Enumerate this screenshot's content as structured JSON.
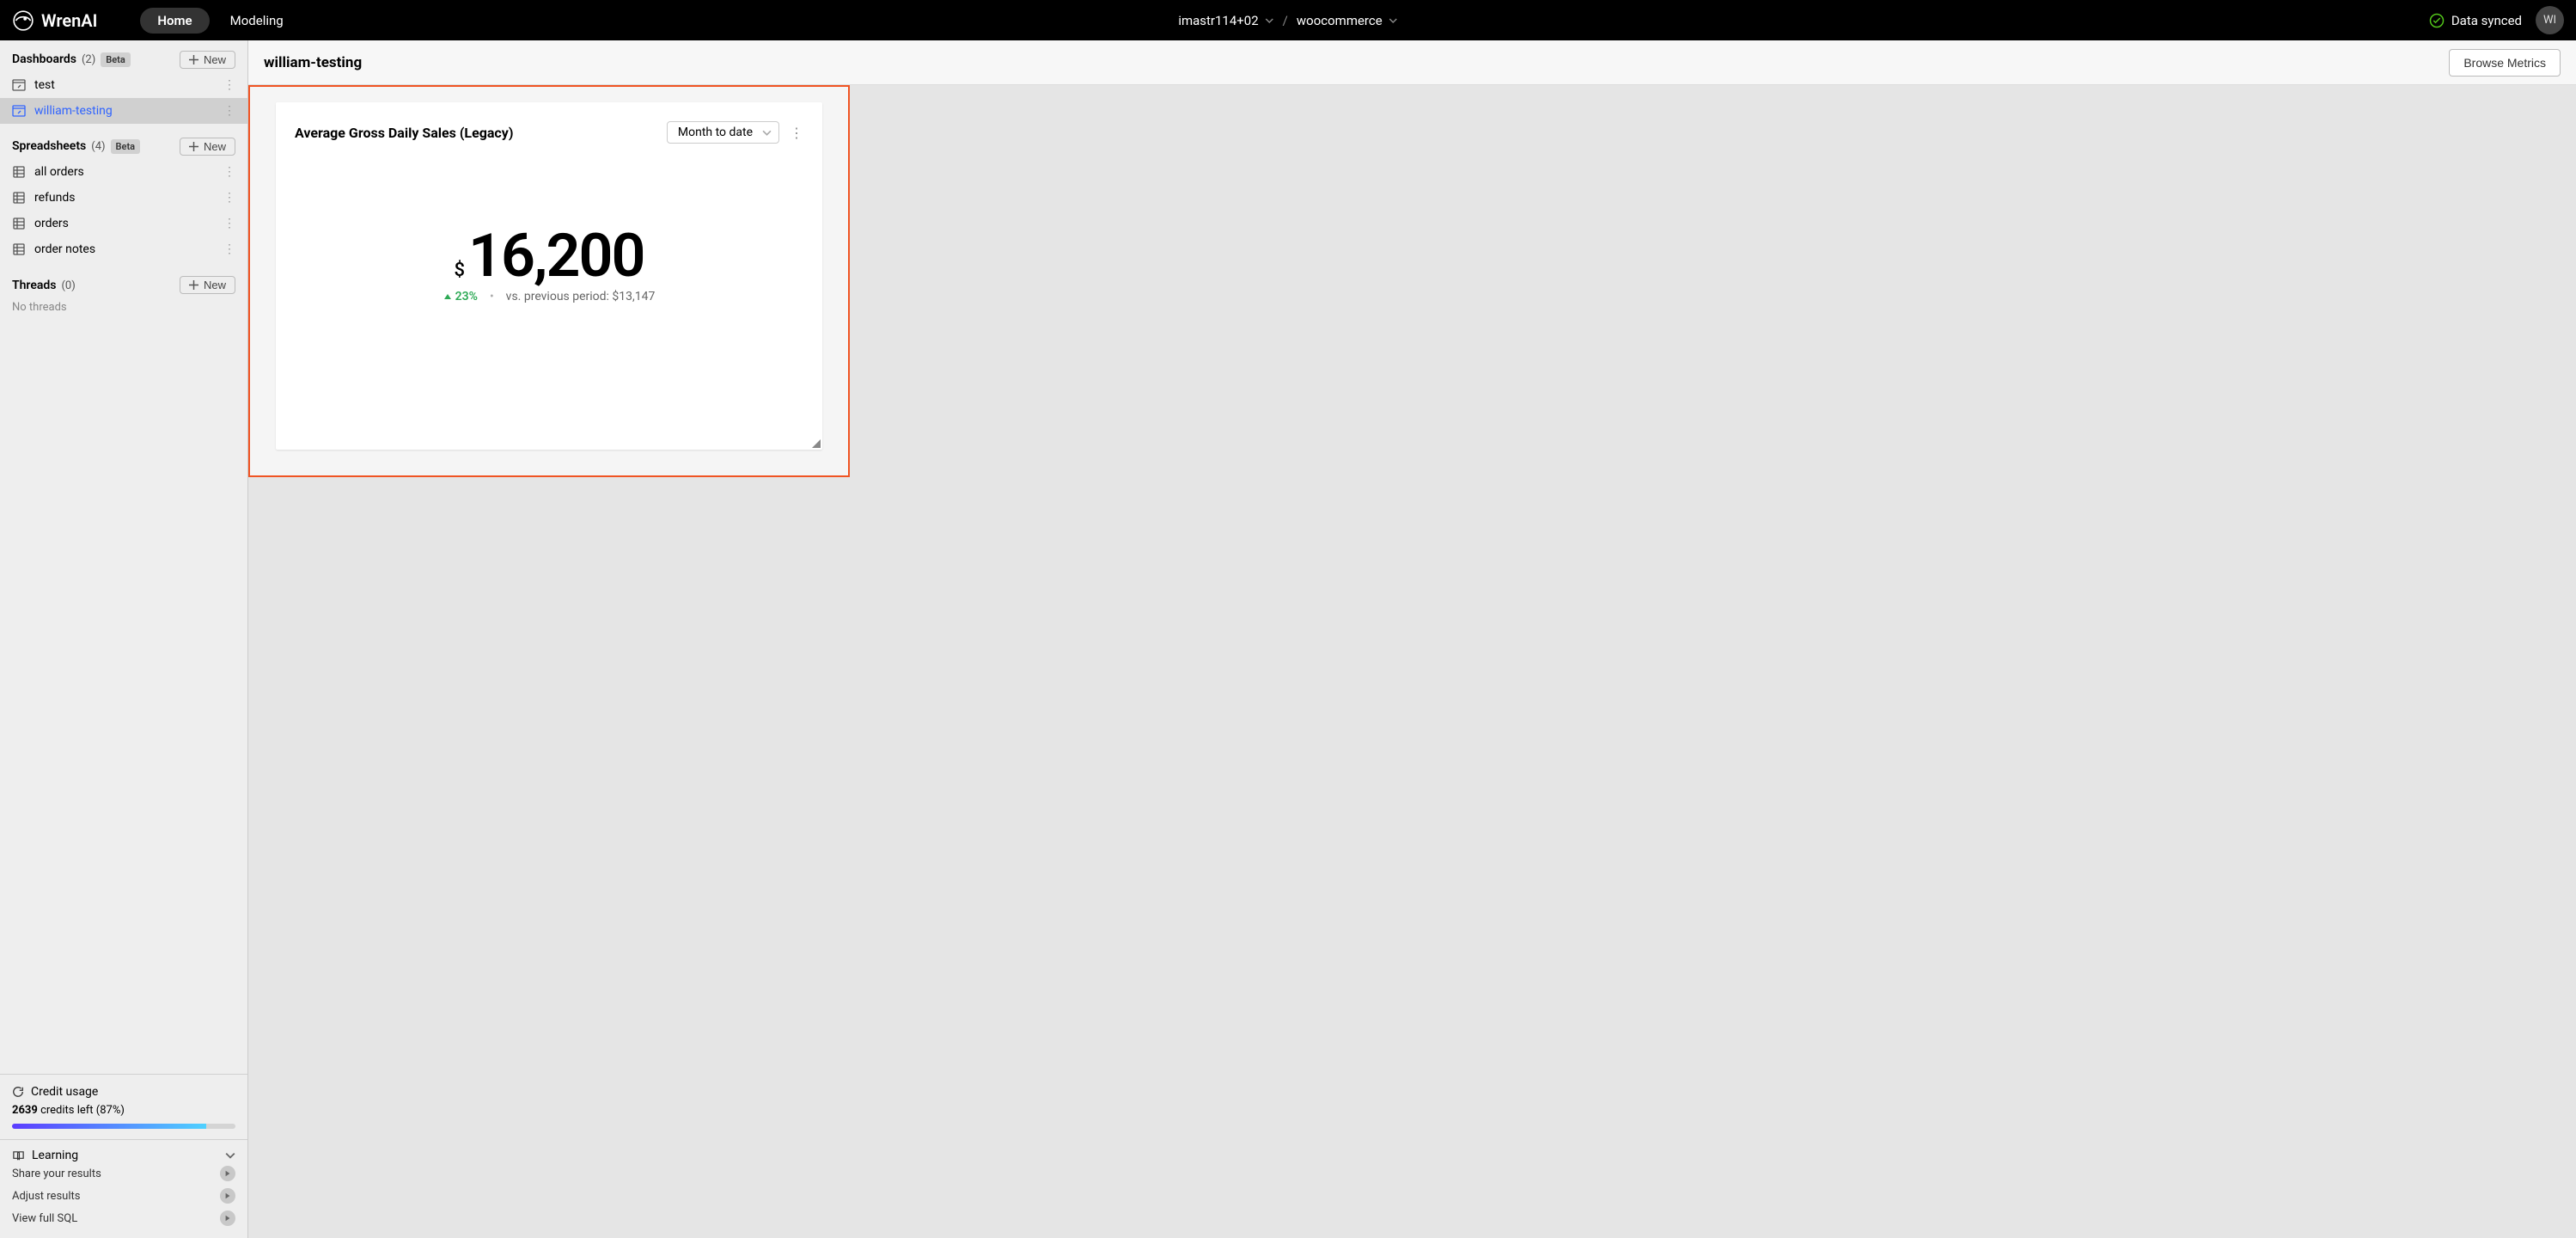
{
  "brand": "WrenAI",
  "nav": {
    "home": "Home",
    "modeling": "Modeling"
  },
  "project": {
    "user": "imastr114+02",
    "name": "woocommerce"
  },
  "sync": {
    "label": "Data synced"
  },
  "avatar": "WI",
  "sidebar": {
    "dashboards": {
      "title": "Dashboards",
      "count": "(2)",
      "beta": "Beta",
      "new": "New",
      "items": [
        {
          "label": "test"
        },
        {
          "label": "william-testing"
        }
      ]
    },
    "spreadsheets": {
      "title": "Spreadsheets",
      "count": "(4)",
      "beta": "Beta",
      "new": "New",
      "items": [
        {
          "label": "all orders"
        },
        {
          "label": "refunds"
        },
        {
          "label": "orders"
        },
        {
          "label": "order notes"
        }
      ]
    },
    "threads": {
      "title": "Threads",
      "count": "(0)",
      "new": "New",
      "empty": "No threads"
    }
  },
  "credit": {
    "title": "Credit usage",
    "bold": "2639",
    "rest": " credits left (87%)",
    "pct": 87
  },
  "learning": {
    "title": "Learning",
    "items": [
      {
        "label": "Share your results"
      },
      {
        "label": "Adjust results"
      },
      {
        "label": "View full SQL"
      }
    ]
  },
  "page": {
    "title": "william-testing",
    "browse": "Browse Metrics"
  },
  "card": {
    "title": "Average Gross Daily Sales (Legacy)",
    "range": "Month to date",
    "prefix": "$",
    "value": "16,200",
    "delta": "23%",
    "prev_label": "vs. previous period: ",
    "prev_value": "$13,147"
  }
}
